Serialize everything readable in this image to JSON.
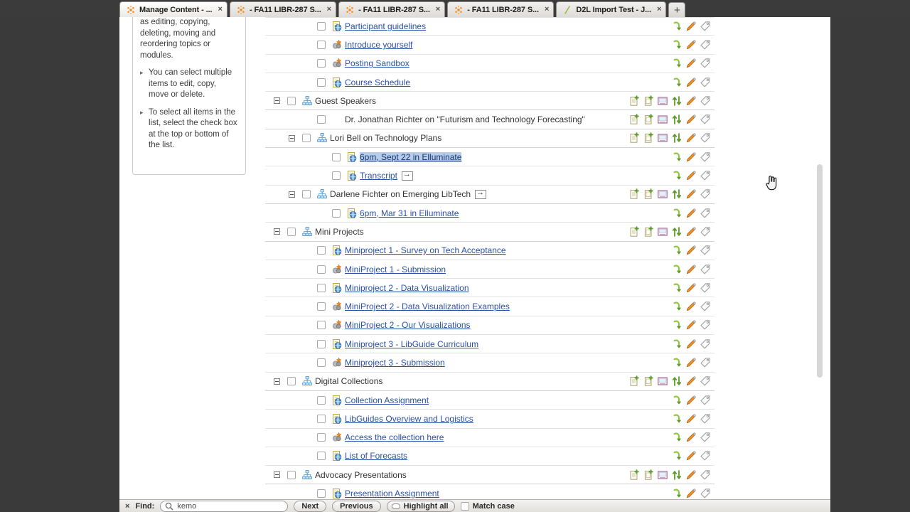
{
  "browser": {
    "tabs": [
      {
        "label": "Manage Content - ...",
        "favicon": "firefox-icon",
        "active": true,
        "close": "×"
      },
      {
        "label": "- FA11 LIBR-287 S...",
        "favicon": "firefox-icon",
        "active": false,
        "close": "×"
      },
      {
        "label": "- FA11 LIBR-287 S...",
        "favicon": "firefox-icon",
        "active": false,
        "close": "×"
      },
      {
        "label": "- FA11 LIBR-287 S...",
        "favicon": "firefox-icon",
        "active": false,
        "close": "×"
      },
      {
        "label": "D2L Import Test - J...",
        "favicon": "page-icon",
        "active": false,
        "close": "×"
      }
    ],
    "new_tab_label": "+"
  },
  "help_panel": {
    "intro": "as editing, copying, deleting, moving and reordering topics or modules.",
    "bullets": [
      "You can select multiple items to edit, copy, move or delete.",
      "To select all items in the list, select the check box at the top or bottom of the list."
    ]
  },
  "content_rows": [
    {
      "indent": 3,
      "toggle": false,
      "checkbox": true,
      "icon": "html-page-icon",
      "label": "Participant guidelines",
      "link": true,
      "highlight": false,
      "arrowbox": false,
      "actions": "topic"
    },
    {
      "indent": 3,
      "toggle": false,
      "checkbox": true,
      "icon": "quicklink-icon",
      "label": "Introduce yourself",
      "link": true,
      "highlight": false,
      "arrowbox": false,
      "actions": "topic"
    },
    {
      "indent": 3,
      "toggle": false,
      "checkbox": true,
      "icon": "quicklink-icon",
      "label": "Posting Sandbox",
      "link": true,
      "highlight": false,
      "arrowbox": false,
      "actions": "topic"
    },
    {
      "indent": 3,
      "toggle": false,
      "checkbox": true,
      "icon": "html-page-icon",
      "label": "Course Schedule",
      "link": true,
      "highlight": false,
      "arrowbox": false,
      "actions": "topic"
    },
    {
      "indent": 1,
      "toggle": true,
      "checkbox": true,
      "icon": "module-icon",
      "label": "Guest Speakers",
      "link": false,
      "highlight": false,
      "arrowbox": false,
      "actions": "module"
    },
    {
      "indent": 3,
      "toggle": false,
      "checkbox": true,
      "icon": "none",
      "label": "Dr. Jonathan Richter on \"Futurism and Technology Forecasting\"",
      "link": false,
      "highlight": false,
      "arrowbox": false,
      "actions": "module"
    },
    {
      "indent": 2,
      "toggle": true,
      "checkbox": true,
      "icon": "module-icon",
      "label": "Lori Bell on Technology Plans",
      "link": false,
      "highlight": false,
      "arrowbox": false,
      "actions": "module"
    },
    {
      "indent": 4,
      "toggle": false,
      "checkbox": true,
      "icon": "html-page-icon",
      "label": "6pm, Sept 22 in Elluminate",
      "link": true,
      "highlight": true,
      "arrowbox": false,
      "actions": "topic"
    },
    {
      "indent": 4,
      "toggle": false,
      "checkbox": true,
      "icon": "html-page-icon",
      "label": "Transcript",
      "link": true,
      "highlight": false,
      "arrowbox": true,
      "actions": "topic"
    },
    {
      "indent": 2,
      "toggle": true,
      "checkbox": true,
      "icon": "module-icon",
      "label": "Darlene Fichter on Emerging LibTech",
      "link": false,
      "highlight": false,
      "arrowbox": true,
      "actions": "module"
    },
    {
      "indent": 4,
      "toggle": false,
      "checkbox": true,
      "icon": "html-page-icon",
      "label": "6pm, Mar 31 in Elluminate",
      "link": true,
      "highlight": false,
      "arrowbox": false,
      "actions": "topic"
    },
    {
      "indent": 1,
      "toggle": true,
      "checkbox": true,
      "icon": "module-icon",
      "label": "Mini Projects",
      "link": false,
      "highlight": false,
      "arrowbox": false,
      "actions": "module"
    },
    {
      "indent": 3,
      "toggle": false,
      "checkbox": true,
      "icon": "html-page-icon",
      "label": "Miniproject 1 - Survey on Tech Acceptance",
      "link": true,
      "highlight": false,
      "arrowbox": false,
      "actions": "topic"
    },
    {
      "indent": 3,
      "toggle": false,
      "checkbox": true,
      "icon": "quicklink-icon",
      "label": "MiniProject 1 - Submission",
      "link": true,
      "highlight": false,
      "arrowbox": false,
      "actions": "topic"
    },
    {
      "indent": 3,
      "toggle": false,
      "checkbox": true,
      "icon": "html-page-icon",
      "label": "Miniproject 2 - Data Visualization",
      "link": true,
      "highlight": false,
      "arrowbox": false,
      "actions": "topic"
    },
    {
      "indent": 3,
      "toggle": false,
      "checkbox": true,
      "icon": "quicklink-icon",
      "label": "MiniProject 2 - Data Visualization Examples",
      "link": true,
      "highlight": false,
      "arrowbox": false,
      "actions": "topic"
    },
    {
      "indent": 3,
      "toggle": false,
      "checkbox": true,
      "icon": "quicklink-icon",
      "label": "MiniProject 2 - Our Visualizations",
      "link": true,
      "highlight": false,
      "arrowbox": false,
      "actions": "topic"
    },
    {
      "indent": 3,
      "toggle": false,
      "checkbox": true,
      "icon": "html-page-icon",
      "label": "Miniproject 3 - LibGuide Curriculum",
      "link": true,
      "highlight": false,
      "arrowbox": false,
      "actions": "topic"
    },
    {
      "indent": 3,
      "toggle": false,
      "checkbox": true,
      "icon": "quicklink-icon",
      "label": "Miniproject 3 - Submission",
      "link": true,
      "highlight": false,
      "arrowbox": false,
      "actions": "topic"
    },
    {
      "indent": 1,
      "toggle": true,
      "checkbox": true,
      "icon": "module-icon",
      "label": "Digital Collections",
      "link": false,
      "highlight": false,
      "arrowbox": false,
      "actions": "module"
    },
    {
      "indent": 3,
      "toggle": false,
      "checkbox": true,
      "icon": "html-page-icon",
      "label": "Collection Assignment",
      "link": true,
      "highlight": false,
      "arrowbox": false,
      "actions": "topic"
    },
    {
      "indent": 3,
      "toggle": false,
      "checkbox": true,
      "icon": "html-page-icon",
      "label": "LibGuides Overview and Logistics",
      "link": true,
      "highlight": false,
      "arrowbox": false,
      "actions": "topic"
    },
    {
      "indent": 3,
      "toggle": false,
      "checkbox": true,
      "icon": "quicklink-icon",
      "label": "Access the collection here",
      "link": true,
      "highlight": false,
      "arrowbox": false,
      "actions": "topic"
    },
    {
      "indent": 3,
      "toggle": false,
      "checkbox": true,
      "icon": "html-page-icon",
      "label": "List of Forecasts",
      "link": true,
      "highlight": false,
      "arrowbox": false,
      "actions": "topic"
    },
    {
      "indent": 1,
      "toggle": true,
      "checkbox": true,
      "icon": "module-icon",
      "label": "Advocacy Presentations",
      "link": false,
      "highlight": false,
      "arrowbox": false,
      "actions": "module"
    },
    {
      "indent": 3,
      "toggle": false,
      "checkbox": true,
      "icon": "html-page-icon",
      "label": "Presentation Assignment",
      "link": true,
      "highlight": false,
      "arrowbox": false,
      "actions": "topic"
    }
  ],
  "row_actions": {
    "module": [
      "new-page-icon",
      "new-file-icon",
      "import-icon",
      "reorder-icon",
      "edit-pencil-icon",
      "tag-icon"
    ],
    "topic": [
      "move-down-icon",
      "edit-pencil-icon",
      "tag-icon"
    ]
  },
  "findbar": {
    "close": "×",
    "label": "Find:",
    "value": "kemo",
    "search_icon": "magnifier-icon",
    "next_label": "Next",
    "previous_label": "Previous",
    "highlight_all_label": "Highlight all",
    "match_case_label": "Match case"
  },
  "colors": {
    "link": "#2a50a8",
    "highlight": "#b8cbe8",
    "accent_green": "#7cb342",
    "accent_orange": "#e8801a",
    "chrome_bg": "#3b3b3b"
  }
}
